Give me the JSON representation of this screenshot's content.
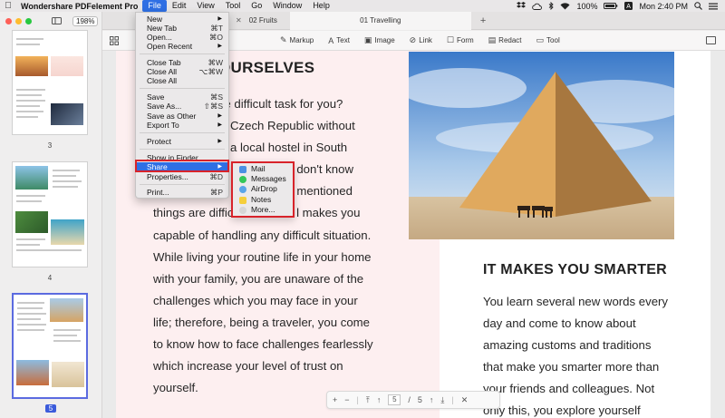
{
  "menubar": {
    "app_name": "Wondershare PDFelement Pro",
    "menus": [
      "File",
      "Edit",
      "View",
      "Tool",
      "Go",
      "Window",
      "Help"
    ],
    "battery": "100%",
    "clock": "Mon 2:40 PM"
  },
  "sidebar": {
    "zoom": "198%",
    "pages": [
      "3",
      "4",
      "5"
    ]
  },
  "tabs": [
    {
      "label": "02 Fruits"
    },
    {
      "label": "01 Travelling"
    }
  ],
  "toolbar": {
    "markup": "Markup",
    "text": "Text",
    "image": "Image",
    "link": "Link",
    "form": "Form",
    "redact": "Redact",
    "tool": "Tool"
  },
  "document": {
    "heading_left": "OURSELVES",
    "para_left_lines": [
      "re difficult task for you?",
      "e Czech Republic without",
      "g a local hostel in South",
      "ou don't know",
      "ne mentioned",
      "things are diffic                   l makes you",
      "capable of handling any difficult situation.",
      "While living your routine life in your home",
      "with your family, you are unaware of the",
      "challenges which you may face in your",
      "life; therefore, being a traveler, you come",
      "to know how to face challenges fearlessly",
      "which increase your level of trust on",
      "yourself."
    ],
    "heading_right": "IT MAKES YOU SMARTER",
    "para_right_lines": [
      "You learn several new words every",
      "day and come to know about",
      "amazing customs and traditions",
      "that make you smarter more than",
      "your friends and colleagues. Not",
      "only this, you explore yourself"
    ]
  },
  "pager": {
    "current": "5",
    "total": "5"
  },
  "file_menu": {
    "items": [
      {
        "label": "New",
        "shortcut": "",
        "submenu": true
      },
      {
        "label": "New Tab",
        "shortcut": "⌘T"
      },
      {
        "label": "Open...",
        "shortcut": "⌘O"
      },
      {
        "label": "Open Recent",
        "shortcut": "",
        "submenu": true
      },
      {
        "label": "Close Tab",
        "shortcut": "⌘W"
      },
      {
        "label": "Close All",
        "shortcut": "⌥⌘W"
      },
      {
        "label": "Close All",
        "shortcut": ""
      },
      {
        "label": "Save",
        "shortcut": "⌘S"
      },
      {
        "label": "Save As...",
        "shortcut": "⇧⌘S"
      },
      {
        "label": "Save as Other",
        "shortcut": "",
        "submenu": true
      },
      {
        "label": "Export To",
        "shortcut": "",
        "submenu": true
      },
      {
        "label": "Protect",
        "shortcut": "",
        "submenu": true
      },
      {
        "label": "Show in Finder",
        "shortcut": ""
      },
      {
        "label": "Share",
        "shortcut": "",
        "submenu": true
      },
      {
        "label": "Properties...",
        "shortcut": "⌘D"
      },
      {
        "label": "Print...",
        "shortcut": "⌘P"
      }
    ]
  },
  "share_menu": {
    "items": [
      "Mail",
      "Messages",
      "AirDrop",
      "Notes",
      "More..."
    ]
  }
}
